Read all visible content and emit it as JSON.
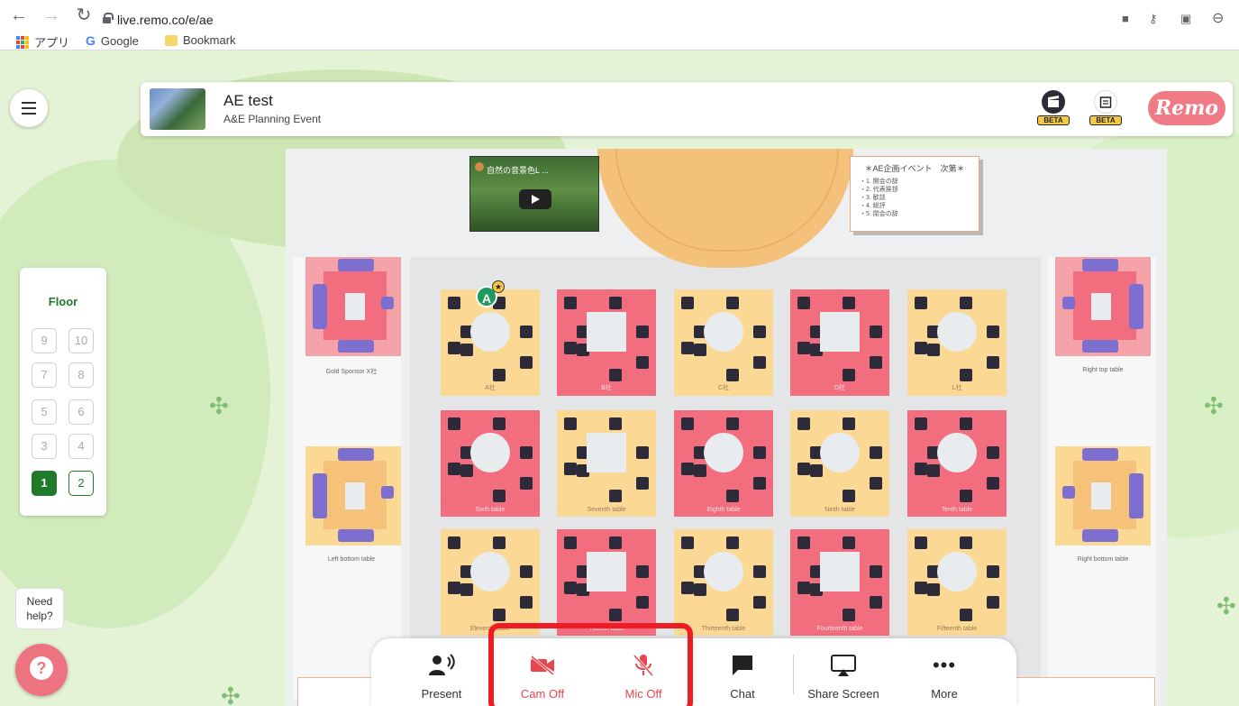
{
  "browser": {
    "url": "live.remo.co/e/ae",
    "bookmarks": [
      "アプリ",
      "Google",
      "Bookmark"
    ]
  },
  "event": {
    "title": "AE test",
    "subtitle": "A&E Planning Event",
    "beta_badge_1": "BETA",
    "beta_badge_2": "BETA",
    "brand": "Remo"
  },
  "stage": {
    "video_title": "自然の音景色L ...",
    "agenda_title": "＊AE企画イベント　次第＊",
    "agenda_items": [
      "・1. 開会の辞",
      "・2. 代表挨拶",
      "・3. 歓談",
      "・4. 総評",
      "・5. 閉会の辞"
    ]
  },
  "floor": {
    "title": "Floor",
    "buttons": [
      "9",
      "10",
      "7",
      "8",
      "5",
      "6",
      "3",
      "4",
      "1",
      "2"
    ],
    "active": "1"
  },
  "tables": {
    "row1": [
      "A社",
      "B社",
      "C社",
      "D社",
      "L社"
    ],
    "row2": [
      "Sixth table",
      "Seventh table",
      "Eighth table",
      "Ninth table",
      "Tenth table"
    ],
    "row3": [
      "Eleventh table",
      "Twelfth table",
      "Thirteenth table",
      "Fourteenth table",
      "Fifteenth table"
    ]
  },
  "side_tables": {
    "gold_sponsor": "Gold Sponsor X社",
    "left_bottom": "Left bottom table",
    "right_top": "Right top table",
    "right_bottom": "Right bottom table"
  },
  "avatar": {
    "initial": "A"
  },
  "help": {
    "text": "Need help?"
  },
  "toolbar": {
    "present": "Present",
    "cam_off": "Cam Off",
    "mic_off": "Mic Off",
    "chat": "Chat",
    "share_screen": "Share Screen",
    "more": "More"
  },
  "colors": {
    "accent_green": "#1f7a2a",
    "brand_pink": "#f07b86",
    "off_red": "#e8464f",
    "highlight_red": "#ee1c25"
  }
}
